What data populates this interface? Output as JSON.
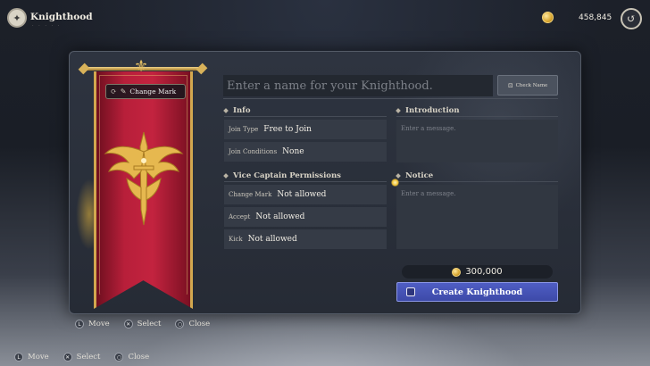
{
  "header": {
    "title": "Knighthood",
    "gold": "458,845"
  },
  "banner": {
    "change_mark_label": "Change Mark"
  },
  "form": {
    "name_placeholder": "Enter a name for your Knighthood.",
    "check_name_label": "Check Name",
    "info": {
      "title": "Info",
      "rows": [
        {
          "key": "Join Type",
          "value": "Free to Join"
        },
        {
          "key": "Join Conditions",
          "value": "None"
        }
      ]
    },
    "permissions": {
      "title": "Vice Captain Permissions",
      "rows": [
        {
          "key": "Change Mark",
          "value": "Not allowed"
        },
        {
          "key": "Accept",
          "value": "Not allowed"
        },
        {
          "key": "Kick",
          "value": "Not allowed"
        }
      ]
    },
    "introduction": {
      "title": "Introduction",
      "placeholder": "Enter a message."
    },
    "notice": {
      "title": "Notice",
      "placeholder": "Enter a message."
    },
    "cost": "300,000",
    "create_label": "Create Knighthood"
  },
  "hints": {
    "inner": [
      {
        "button": "L",
        "label": "Move"
      },
      {
        "button": "✕",
        "label": "Select"
      },
      {
        "button": "○",
        "label": "Close"
      }
    ],
    "outer": [
      {
        "button": "L",
        "label": "Move"
      },
      {
        "button": "✕",
        "label": "Select"
      },
      {
        "button": "○",
        "label": "Close"
      }
    ]
  },
  "colors": {
    "banner_red": "#c3233f",
    "create_button": "#4f5ec4",
    "gold_trim": "#d2a84f"
  },
  "icons": [
    "knighthood-crest-icon",
    "gold-coin-icon",
    "back-icon",
    "refresh-icon",
    "pencil-icon",
    "check-name-icon"
  ]
}
